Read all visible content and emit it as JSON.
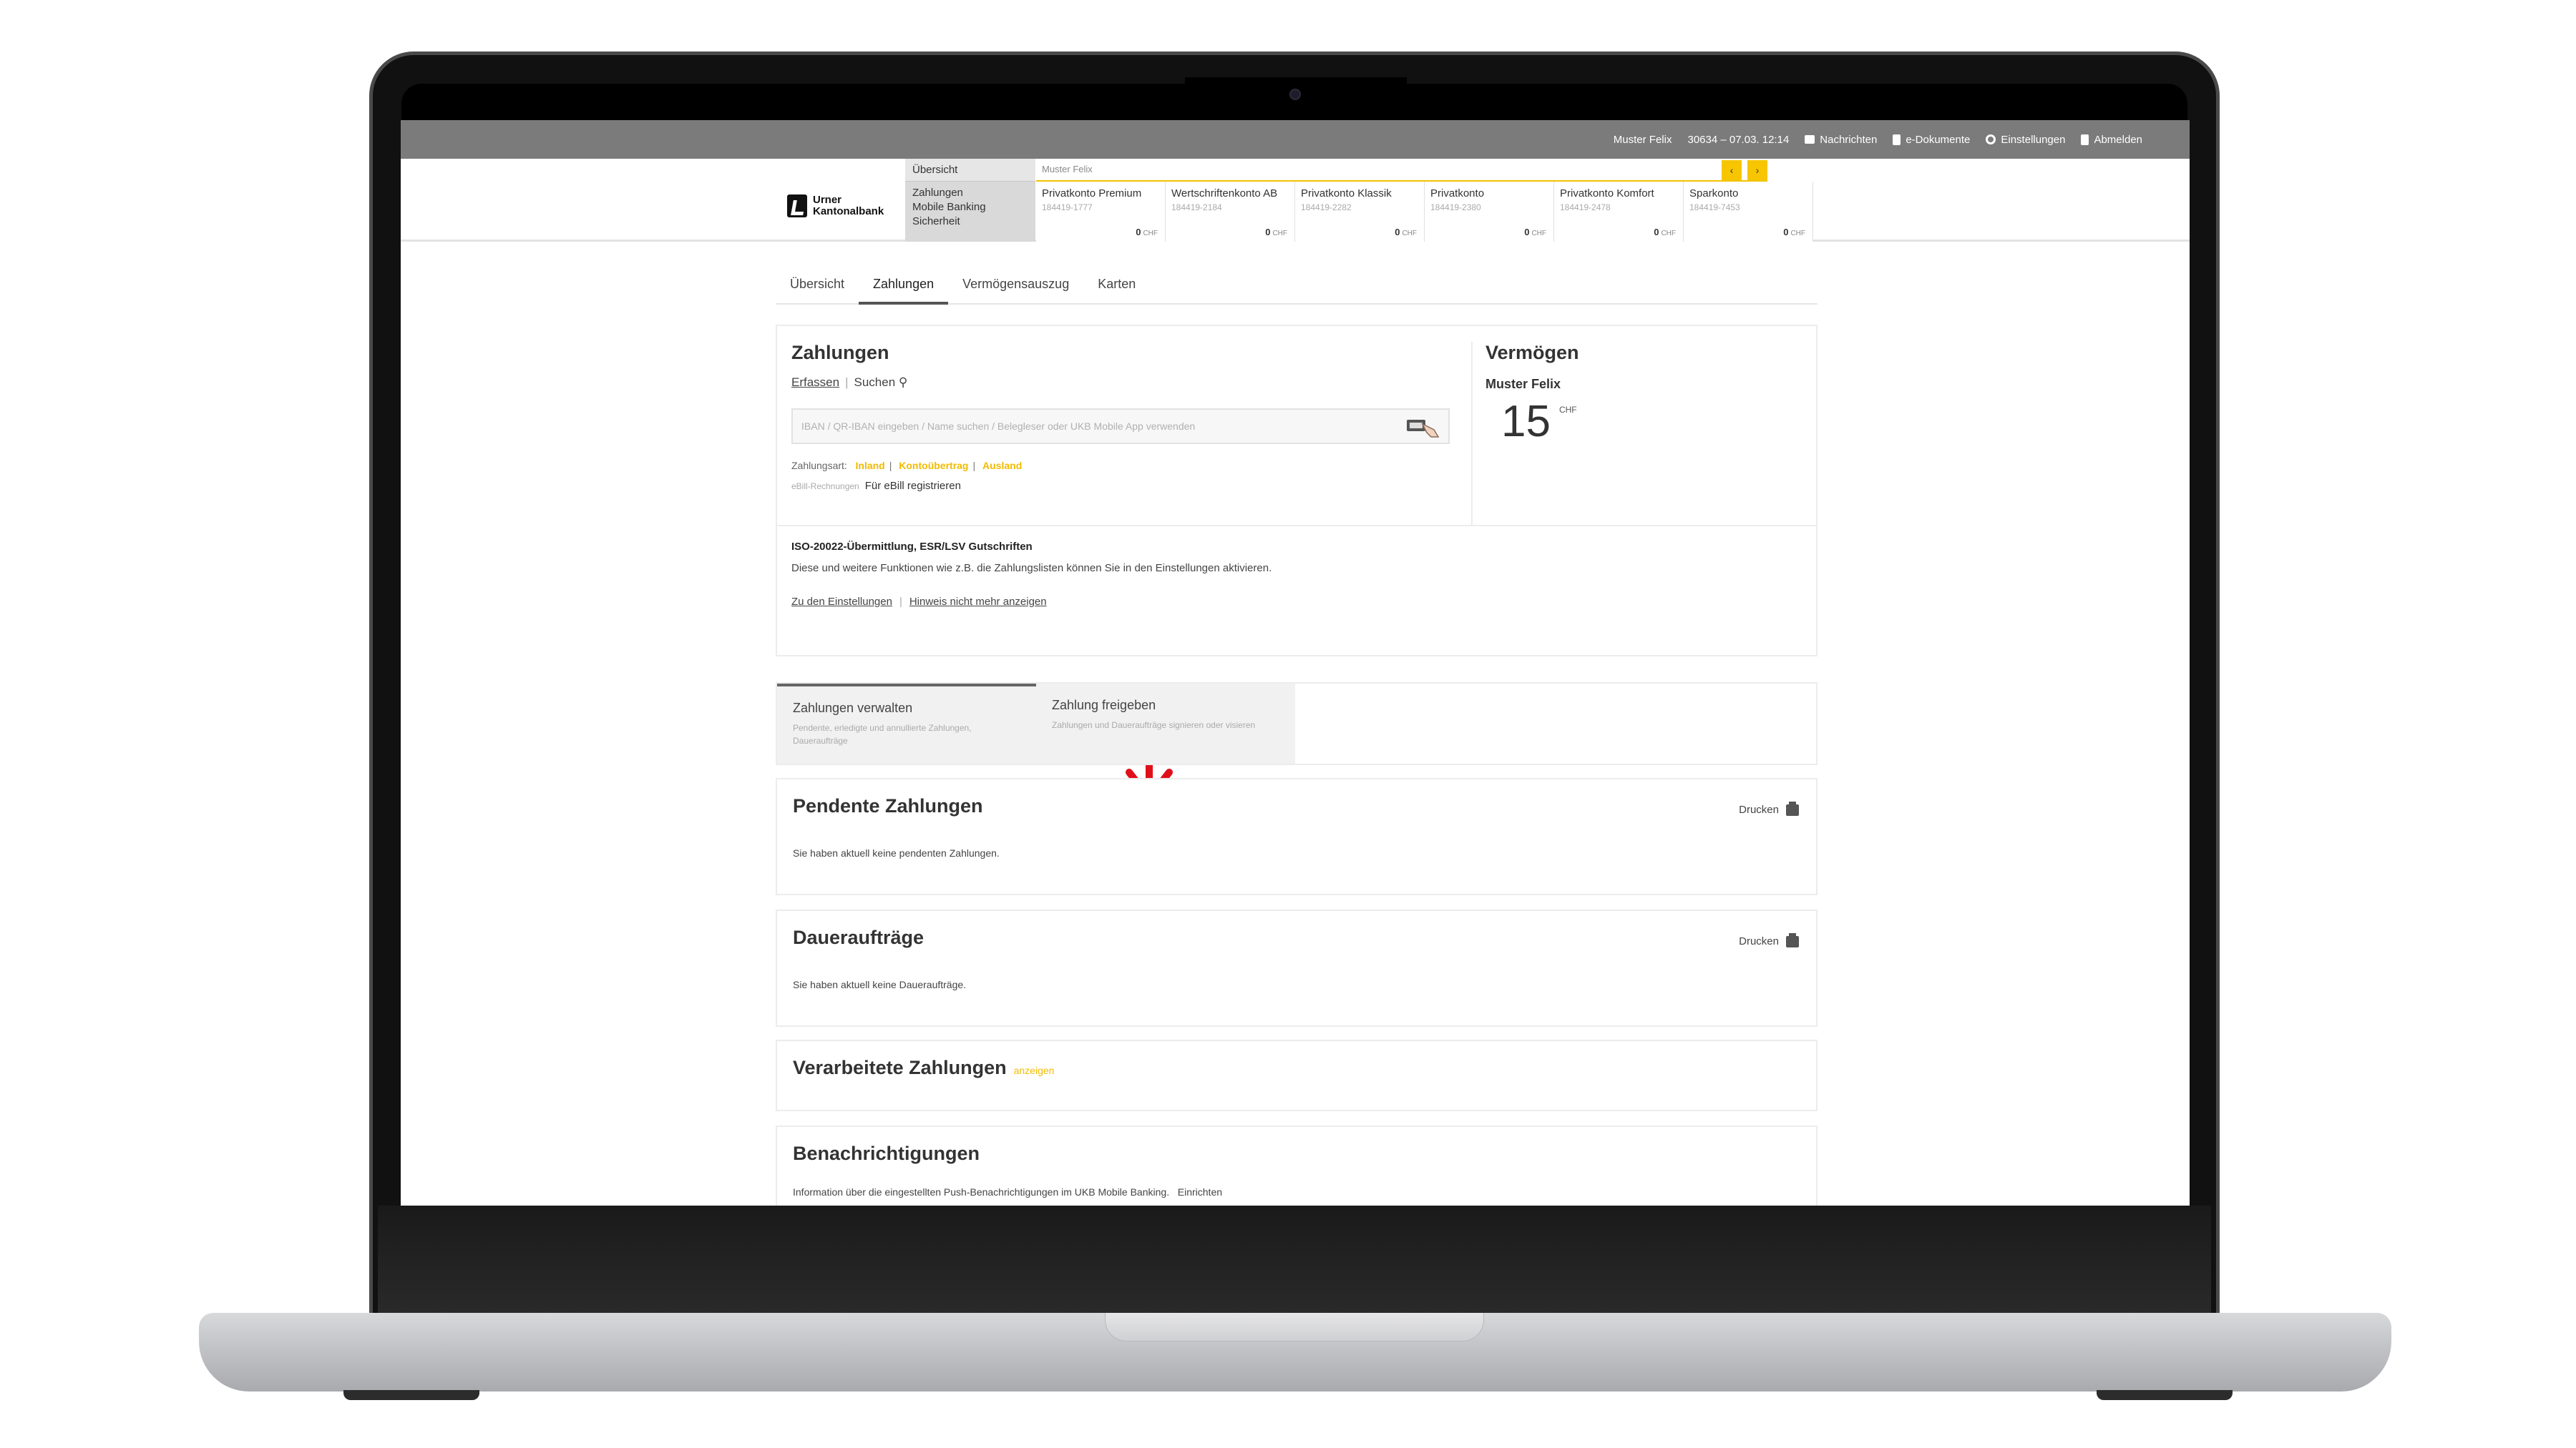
{
  "topbar": {
    "user": "Muster Felix",
    "session": "30634 – 07.03. 12:14",
    "messages": "Nachrichten",
    "documents": "e-Dokumente",
    "settings": "Einstellungen",
    "logout": "Abmelden"
  },
  "brand": {
    "line1": "Urner",
    "line2": "Kantonalbank"
  },
  "main_menu": {
    "top": "Übersicht",
    "items": [
      "Zahlungen",
      "Mobile Banking",
      "Sicherheit"
    ]
  },
  "account_bar": {
    "owner": "Muster Felix",
    "prev": "‹",
    "next": "›",
    "accounts": [
      {
        "name": "Privatkonto Premium",
        "iban": "184419-1777",
        "balance": "0",
        "currency": "CHF"
      },
      {
        "name": "Wertschriftenkonto AB",
        "iban": "184419-2184",
        "balance": "0",
        "currency": "CHF"
      },
      {
        "name": "Privatkonto Klassik",
        "iban": "184419-2282",
        "balance": "0",
        "currency": "CHF"
      },
      {
        "name": "Privatkonto",
        "iban": "184419-2380",
        "balance": "0",
        "currency": "CHF"
      },
      {
        "name": "Privatkonto Komfort",
        "iban": "184419-2478",
        "balance": "0",
        "currency": "CHF"
      },
      {
        "name": "Sparkonto",
        "iban": "184419-7453",
        "balance": "0",
        "currency": "CHF"
      }
    ]
  },
  "tabs": [
    "Übersicht",
    "Zahlungen",
    "Vermögensauszug",
    "Karten"
  ],
  "payments": {
    "title": "Zahlungen",
    "link_capture": "Erfassen",
    "link_separator": "|",
    "link_search": "Suchen",
    "search_placeholder": "IBAN / QR-IBAN eingeben / Name suchen / Belegleser oder UKB Mobile App verwenden",
    "types_label": "Zahlungsart:",
    "types": [
      "Inland",
      "Kontoübertrag",
      "Ausland"
    ],
    "ebill_label": "eBill-Rechnungen",
    "ebill_link": "Für eBill registrieren"
  },
  "assets": {
    "title": "Vermögen",
    "owner": "Muster Felix",
    "amount": "15",
    "currency": "CHF"
  },
  "iso_notice": {
    "title": "ISO-20022-Übermittlung, ESR/LSV Gutschriften",
    "text": "Diese und weitere Funktionen wie z.B. die Zahlungslisten können Sie in den Einstellungen aktivieren.",
    "link_settings": "Zu den Einstellungen",
    "link_hide": "Hinweis nicht mehr anzeigen"
  },
  "segments": [
    {
      "title": "Zahlungen verwalten",
      "desc": "Pendente, erledigte und annullierte Zahlungen, Daueraufträge"
    },
    {
      "title": "Zahlung freigeben",
      "desc": "Zahlungen und Daueraufträge signieren oder visieren"
    }
  ],
  "pending": {
    "title": "Pendente Zahlungen",
    "print": "Drucken",
    "message": "Sie haben aktuell keine pendenten Zahlungen."
  },
  "standing_orders": {
    "title": "Daueraufträge",
    "print": "Drucken",
    "message": "Sie haben aktuell keine Daueraufträge."
  },
  "processed": {
    "title": "Verarbeitete Zahlungen",
    "show": "anzeigen"
  },
  "notifications": {
    "title": "Benachrichtigungen",
    "message": "Information über die eingestellten Push-Benachrichtigungen im UKB Mobile Banking.",
    "setup": "Einrichten"
  },
  "colors": {
    "accent": "#f7c600",
    "arrow": "#e0101a",
    "topbar": "#7b7b7b"
  }
}
